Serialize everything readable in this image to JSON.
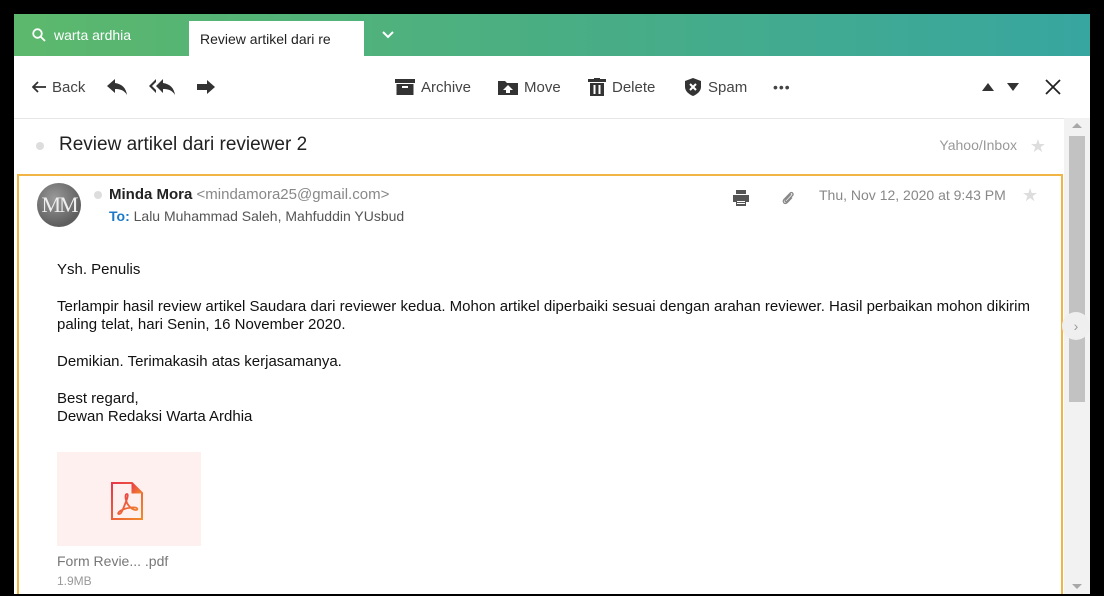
{
  "tabs": {
    "search_label": "warta ardhia",
    "active_label": "Review artikel dari re"
  },
  "toolbar": {
    "back_label": "Back",
    "archive_label": "Archive",
    "move_label": "Move",
    "delete_label": "Delete",
    "spam_label": "Spam",
    "more_label": "•••"
  },
  "message": {
    "subject": "Review artikel dari reviewer 2",
    "folder": "Yahoo/Inbox",
    "sender_name": "Minda Mora",
    "sender_email": "<mindamora25@gmail.com>",
    "to_label": "To:",
    "recipients": "Lalu Muhammad Saleh,  Mahfuddin YUsbud",
    "date": "Thu, Nov 12, 2020 at 9:43 PM",
    "avatar_initials": "MM",
    "body": {
      "greeting": "Ysh. Penulis",
      "paragraph1": "Terlampir hasil review artikel Saudara dari reviewer kedua. Mohon artikel diperbaiki sesuai dengan arahan reviewer. Hasil perbaikan mohon dikirim paling telat, hari Senin, 16 November 2020.",
      "paragraph2": "Demikian. Terimakasih atas kerjasamanya.",
      "closing1": "Best regard,",
      "closing2": "Dewan Redaksi Warta Ardhia"
    },
    "attachment": {
      "name": "Form Revie...  .pdf",
      "size": "1.9MB"
    }
  },
  "colors": {
    "tabbar_start": "#5cb86c",
    "tabbar_end": "#38a6a0",
    "focus_border": "#f0b544",
    "recipient_label": "#1c79c9",
    "pdf_icon": "#e8364a"
  }
}
